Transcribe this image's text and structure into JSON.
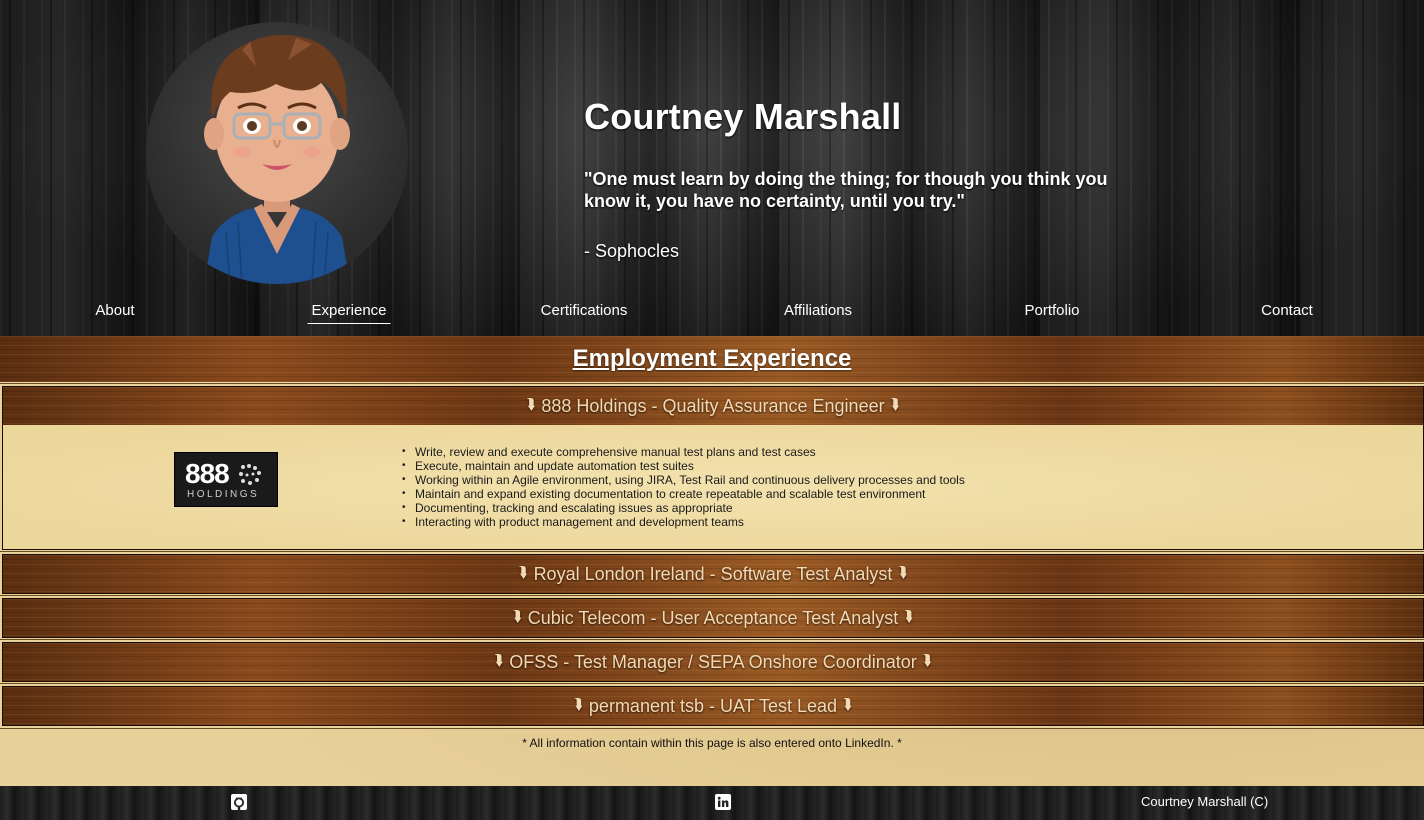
{
  "header": {
    "name": "Courtney Marshall",
    "quote": "\"One must learn by doing the thing; for though you think you know it, you have no certainty, until you try.\"",
    "author": "- Sophocles"
  },
  "nav": {
    "items": [
      {
        "label": "About"
      },
      {
        "label": "Experience"
      },
      {
        "label": "Certifications"
      },
      {
        "label": "Affiliations"
      },
      {
        "label": "Portfolio"
      },
      {
        "label": "Contact"
      }
    ],
    "active": "Experience"
  },
  "experience": {
    "title": "Employment Experience",
    "jobs": [
      {
        "title": "888 Holdings - Quality Assurance Engineer",
        "expanded": true,
        "logo": {
          "number": "888",
          "sub": "HOLDINGS"
        },
        "duties": [
          "Write, review and execute comprehensive manual test plans and test cases",
          "Execute, maintain and update automation test suites",
          "Working within an Agile environment, using JIRA, Test Rail and continuous delivery processes and tools",
          "Maintain and expand existing documentation to create repeatable and scalable test environment",
          "Documenting, tracking and escalating issues as appropriate",
          "Interacting with product management and development teams"
        ]
      },
      {
        "title": "Royal London Ireland - Software Test Analyst",
        "expanded": false
      },
      {
        "title": "Cubic Telecom - User Acceptance Test Analyst",
        "expanded": false
      },
      {
        "title": "OFSS - Test Manager / SEPA Onshore Coordinator",
        "expanded": false
      },
      {
        "title": "permanent tsb - UAT Test Lead",
        "expanded": false
      }
    ],
    "footnote": "* All information contain within this page is also entered onto LinkedIn. *"
  },
  "footer": {
    "icons": [
      "github-icon",
      "linkedin-icon"
    ],
    "copyright": "Courtney Marshall (C)"
  },
  "colors": {
    "header_bg": "#222222",
    "wood_dark": "#5a2e10",
    "wood_light": "#9a5a24",
    "parchment": "#e8d29a",
    "job_title_text": "#f3d9b4"
  }
}
